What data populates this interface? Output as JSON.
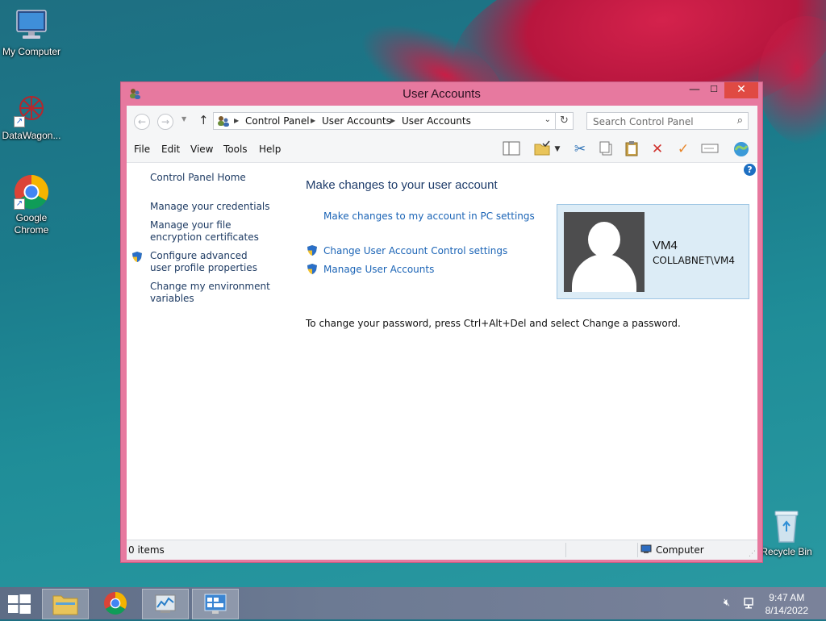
{
  "desktop": {
    "icons": [
      {
        "label": "My Computer",
        "icon": "monitor-icon"
      },
      {
        "label": "DataWagon...",
        "icon": "datawagon-icon"
      },
      {
        "label": "Google Chrome",
        "icon": "chrome-icon"
      },
      {
        "label": "Recycle Bin",
        "icon": "recycle-bin-icon"
      }
    ]
  },
  "window": {
    "title": "User Accounts",
    "controls": {
      "minimize": "—",
      "maximize": "☐",
      "close": "✕"
    },
    "address": {
      "crumbs": [
        "Control Panel",
        "User Accounts",
        "User Accounts"
      ],
      "search_placeholder": "Search Control Panel"
    },
    "menu": [
      "File",
      "Edit",
      "View",
      "Tools",
      "Help"
    ],
    "toolbar_icons": [
      "layout-pane-icon",
      "folder-options-icon",
      "cut-icon",
      "copy-icon",
      "paste-icon",
      "delete-icon",
      "properties-check-icon",
      "rename-icon",
      "internet-icon"
    ],
    "left_pane": {
      "home": "Control Panel Home",
      "links": [
        "Manage your credentials",
        "Manage your file encryption certificates",
        "Configure advanced user profile properties",
        "Change my environment variables"
      ]
    },
    "main": {
      "heading": "Make changes to your user account",
      "pc_settings_link": "Make changes to my account in PC settings",
      "uac_link": "Change User Account Control settings",
      "manage_link": "Manage User Accounts",
      "password_note": "To change your password, press Ctrl+Alt+Del and select Change a password."
    },
    "user": {
      "name": "VM4",
      "domain": "COLLABNET\\VM4"
    },
    "status": {
      "items": "0 items",
      "location": "Computer"
    }
  },
  "taskbar": {
    "time": "9:47 AM",
    "date": "8/14/2022"
  },
  "colors": {
    "window_frame": "#e7799f",
    "close_button": "#e04a43",
    "link": "#1b64b6",
    "heading": "#1e3c6a",
    "user_card_bg": "#dcecf6"
  }
}
